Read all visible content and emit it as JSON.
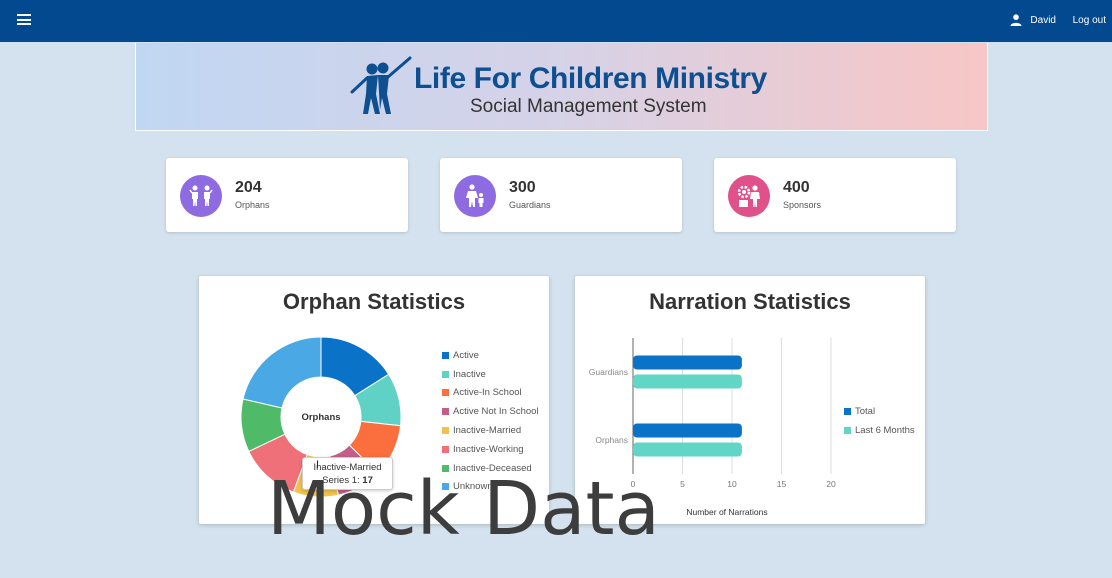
{
  "topbar": {
    "menu_icon": "hamburger-icon",
    "user_icon": "person-icon",
    "user_name": "David",
    "logout_label": "Log out",
    "bg_color": "#03498f"
  },
  "banner": {
    "logo_icon": "children-figures-logo",
    "org_name": "Life For Children Ministry",
    "subtitle": "Social Management System"
  },
  "stats": [
    {
      "value": "204",
      "label": "Orphans",
      "icon": "children-icon",
      "color": "#8e6be0"
    },
    {
      "value": "300",
      "label": "Guardians",
      "icon": "guardian-child-icon",
      "color": "#8e6be0"
    },
    {
      "value": "400",
      "label": "Sponsors",
      "icon": "sponsor-icon",
      "color": "#e0508a"
    }
  ],
  "orphan_panel": {
    "title": "Orphan Statistics",
    "center_label": "Orphans",
    "tooltip": {
      "category": "Inactive-Married",
      "series": "Series 1:",
      "value": "17"
    }
  },
  "narration_panel": {
    "title": "Narration Statistics",
    "xlabel": "Number of Narrations"
  },
  "chart_data": [
    {
      "type": "pie",
      "title": "Orphan Statistics",
      "categories": [
        "Active",
        "Inactive",
        "Active-In School",
        "Active Not In School",
        "Inactive-Married",
        "Inactive-Working",
        "Inactive-Deceased",
        "Unknown"
      ],
      "series": [
        {
          "name": "Series 1",
          "values": [
            30,
            20,
            20,
            17,
            17,
            23,
            20,
            40
          ]
        }
      ],
      "colors": [
        "#0a72c7",
        "#5fd2c5",
        "#fa6f3d",
        "#c35e8a",
        "#f1c14b",
        "#f07079",
        "#4fbb68",
        "#4aa9e5"
      ],
      "legend": "right"
    },
    {
      "type": "bar",
      "title": "Narration Statistics",
      "orientation": "horizontal",
      "categories": [
        "Guardians",
        "Orphans"
      ],
      "series": [
        {
          "name": "Total",
          "values": [
            11,
            11
          ]
        },
        {
          "name": "Last 6 Months",
          "values": [
            11,
            11
          ]
        }
      ],
      "colors": [
        "#0a72c7",
        "#62d6c6"
      ],
      "xlabel": "Number of Narrations",
      "xlim": [
        0,
        20
      ],
      "xticks": [
        "0",
        "5",
        "10",
        "15",
        "20"
      ],
      "grid": true,
      "legend": "right"
    }
  ],
  "watermark": "Mock Data"
}
